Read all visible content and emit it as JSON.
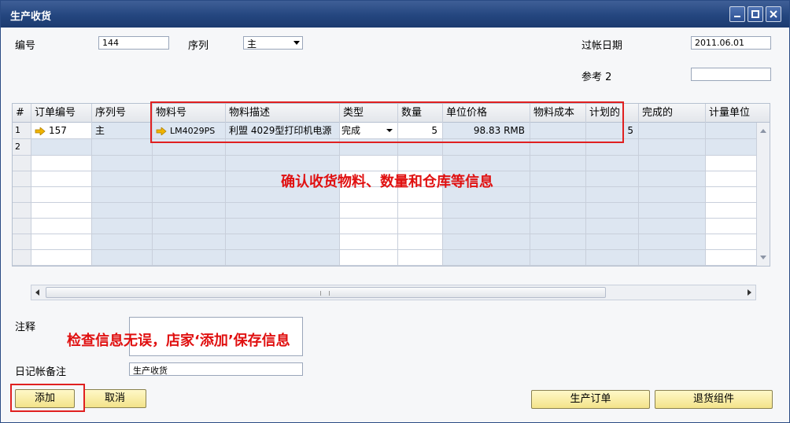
{
  "window": {
    "title": "生产收货"
  },
  "header": {
    "number_label": "编号",
    "number_value": "144",
    "series_label": "序列",
    "series_value": "主",
    "posting_date_label": "过帐日期",
    "posting_date_value": "2011.06.01",
    "ref2_label": "参考 2",
    "ref2_value": ""
  },
  "grid": {
    "columns": [
      "#",
      "订单编号",
      "序列号",
      "物料号",
      "物料描述",
      "类型",
      "数量",
      "单位价格",
      "物料成本",
      "计划的",
      "完成的",
      "计量单位"
    ],
    "rows": [
      {
        "num": "1",
        "order_no": "157",
        "series": "主",
        "item_no": "LM4029PS",
        "description": "利盟 4029型打印机电源",
        "type": "完成",
        "qty": "5",
        "unit_price": "98.83 RMB",
        "item_cost": "",
        "planned": "5",
        "completed": "",
        "uom": ""
      },
      {
        "num": "2",
        "order_no": "",
        "series": "",
        "item_no": "",
        "description": "",
        "type": "",
        "qty": "",
        "unit_price": "",
        "item_cost": "",
        "planned": "",
        "completed": "",
        "uom": ""
      }
    ]
  },
  "footer": {
    "remarks_label": "注释",
    "remarks_value": "",
    "journal_label": "日记帐备注",
    "journal_value": "生产收货"
  },
  "buttons": {
    "add": "添加",
    "cancel": "取消",
    "production_order": "生产订单",
    "return_components": "退货组件"
  },
  "annotations": {
    "grid_note": "确认收货物料、数量和仓库等信息",
    "save_note": "检查信息无误，店家‘添加’保存信息"
  },
  "colors": {
    "title_bar": "#24467f",
    "annotation": "#e01010",
    "button": "#f3e38a",
    "link_arrow": "#f0b400"
  }
}
